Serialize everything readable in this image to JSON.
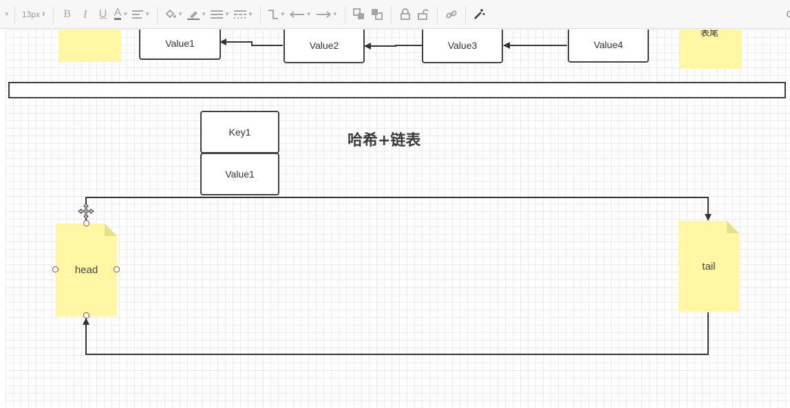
{
  "toolbar": {
    "font_size": "13px",
    "right_label": "C"
  },
  "diagram": {
    "top_values": [
      "Value1",
      "Value2",
      "Value3",
      "Value4"
    ],
    "note_top_right": "表尾",
    "title": "哈希+链表",
    "entry_key": "Key1",
    "entry_value": "Value1",
    "head_label": "head",
    "tail_label": "tail"
  },
  "colors": {
    "note_fill": "#fff7a3",
    "stroke": "#3f3f3f",
    "handle": "#a04a3a"
  },
  "icons": [
    "bold-icon",
    "italic-icon",
    "underline-icon",
    "font-color-icon",
    "align-icon",
    "fill-color-icon",
    "line-color-icon",
    "line-width-icon",
    "line-dash-icon",
    "waypoint-icon",
    "line-start-icon",
    "line-end-icon",
    "to-front-icon",
    "to-back-icon",
    "lock-icon",
    "unlock-icon",
    "link-icon",
    "magic-wand-icon"
  ]
}
